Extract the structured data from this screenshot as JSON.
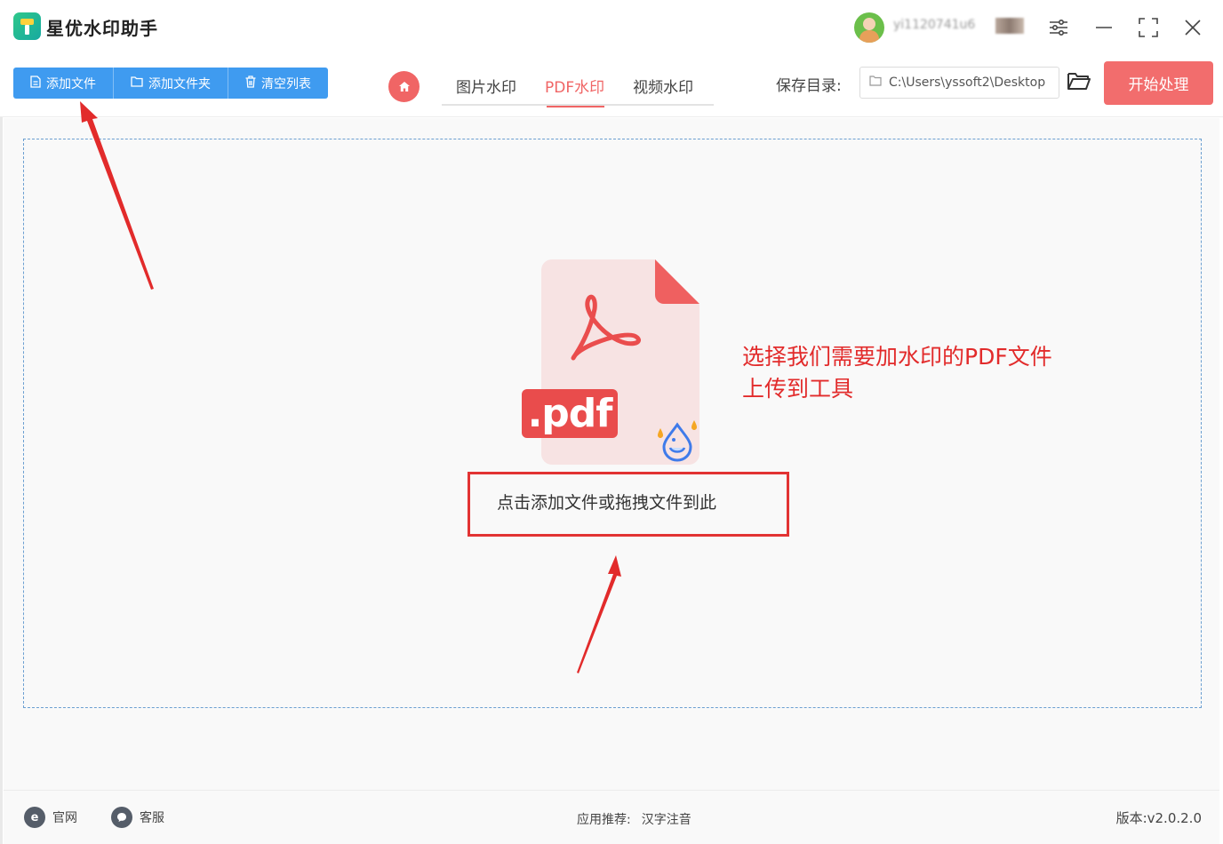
{
  "app": {
    "title": "星优水印助手",
    "username_masked": "yi1120741u6"
  },
  "toolbar": {
    "add_file": "添加文件",
    "add_folder": "添加文件夹",
    "clear_list": "清空列表"
  },
  "tabs": [
    {
      "label": "图片水印",
      "active": false
    },
    {
      "label": "PDF水印",
      "active": true
    },
    {
      "label": "视频水印",
      "active": false
    }
  ],
  "save": {
    "label": "保存目录:",
    "path": "C:\\Users\\yssoft2\\Desktop"
  },
  "start_button": "开始处理",
  "dropzone": {
    "badge": ".pdf",
    "hint": "点击添加文件或拖拽文件到此",
    "annotation_line1": "选择我们需要加水印的PDF文件",
    "annotation_line2": "上传到工具"
  },
  "footer": {
    "website": "官网",
    "support": "客服",
    "recommend_label": "应用推荐:",
    "recommend_app": "汉字注音",
    "version": "版本:v2.0.2.0"
  },
  "colors": {
    "accent_blue": "#3f9bf0",
    "accent_red": "#f06565",
    "annotation_red": "#e22b2b"
  }
}
